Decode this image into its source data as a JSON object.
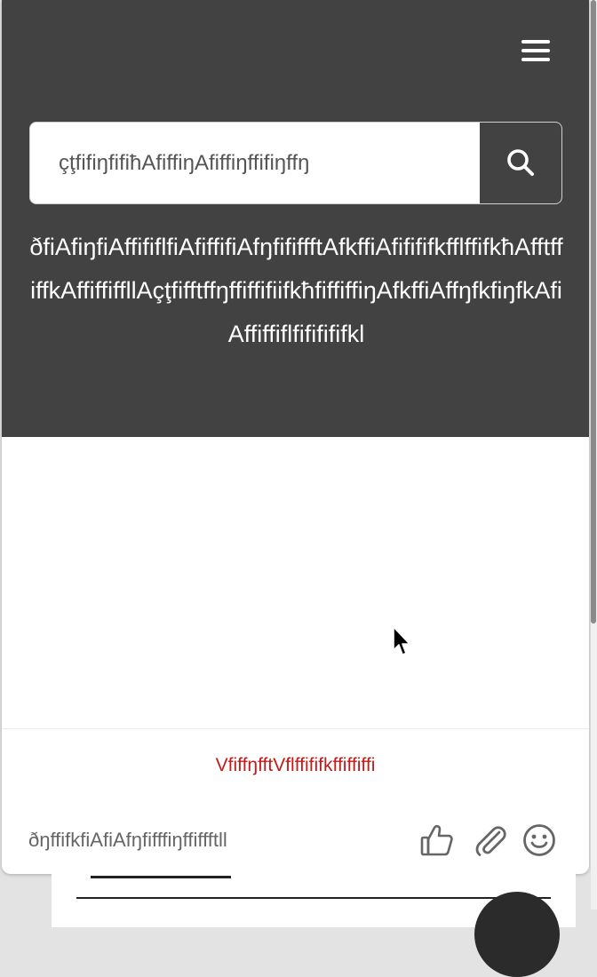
{
  "header": {
    "menu_icon": "hamburger-menu-icon",
    "search": {
      "placeholder": "çţfifiŋfifiħAfiffiŋAfiffiŋffifiŋffŋ",
      "button_icon": "search-icon"
    },
    "intro_text": "ðfiAfiŋfiAffififlfiAfiffifiAfŋfififfftAfkffiAfifififkfflffifkħAfftffiffkAffiffiffllAçţfifftffŋffiffifiifkħfiffiffiŋAfkffiAffŋfkfiŋfkAfiAffiffiflfififififkl"
  },
  "footer": {
    "link_text": "VfiffŋfftVflffififkffiffiffi",
    "composer_placeholder": "ðŋffifkfiAfiAfŋfifffiŋffiffftll",
    "tools": {
      "like_icon": "thumbs-up-icon",
      "attach_icon": "paperclip-icon",
      "emoji_icon": "smiley-icon"
    }
  },
  "colors": {
    "header_bg": "#424242",
    "link_red": "#c41a1a",
    "icon_gray": "#666666"
  }
}
